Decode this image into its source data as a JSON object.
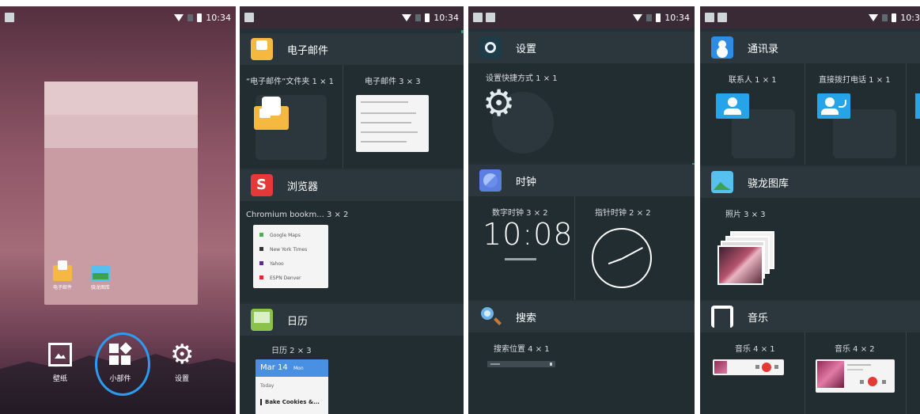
{
  "status": {
    "time": "10:34",
    "time_clipped": "10:3"
  },
  "home": {
    "apps": [
      {
        "label": "电子邮件",
        "icon": "mail-icon"
      },
      {
        "label": "骁龙图库",
        "icon": "gallery-icon"
      }
    ],
    "buttons": [
      {
        "label": "壁纸",
        "icon": "wallpaper-icon"
      },
      {
        "label": "小部件",
        "icon": "widgets-icon",
        "selected": true
      },
      {
        "label": "设置",
        "icon": "gear-icon"
      }
    ]
  },
  "panel2": {
    "sections": [
      {
        "title": "电子邮件",
        "icon": "email-app-icon",
        "widgets": [
          {
            "label": "“电子邮件”文件夹 1 × 1"
          },
          {
            "label": "电子邮件 3 × 3"
          }
        ]
      },
      {
        "title": "浏览器",
        "icon": "browser-icon",
        "widgets": [
          {
            "label": "Chromium bookm... 3 × 2"
          }
        ],
        "bookmarks": [
          "Google Maps",
          "New York Times",
          "Yahoo",
          "ESPN Denver"
        ]
      },
      {
        "title": "日历",
        "icon": "calendar-icon",
        "widgets": [
          {
            "label": "日历 2 × 3"
          }
        ],
        "calendar": {
          "date": "Mar 14",
          "day": "Mon",
          "today": "Today",
          "event": "Bake Cookies &..."
        }
      }
    ]
  },
  "panel3": {
    "sections": [
      {
        "title": "设置",
        "icon": "settings-app-icon",
        "widgets": [
          {
            "label": "设置快捷方式 1 × 1"
          }
        ]
      },
      {
        "title": "时钟",
        "icon": "clock-app-icon",
        "widgets": [
          {
            "label": "数字时钟 3 × 2",
            "time": "10:08"
          },
          {
            "label": "指针时钟 2 × 2"
          }
        ]
      },
      {
        "title": "搜索",
        "icon": "search-app-icon",
        "widgets": [
          {
            "label": "搜索位置 4 × 1"
          }
        ]
      }
    ]
  },
  "panel4": {
    "sections": [
      {
        "title": "通讯录",
        "icon": "contacts-app-icon",
        "widgets": [
          {
            "label": "联系人 1 × 1"
          },
          {
            "label": "直接拨打电话 1 × 1"
          }
        ]
      },
      {
        "title": "骁龙图库",
        "icon": "gallery-app-icon",
        "widgets": [
          {
            "label": "照片 3 × 3"
          }
        ]
      },
      {
        "title": "音乐",
        "icon": "music-app-icon",
        "widgets": [
          {
            "label": "音乐 4 × 1"
          },
          {
            "label": "音乐 4 × 2"
          }
        ]
      }
    ]
  },
  "colors": {
    "accent_ring": "#2d9bf0",
    "panel_bg": "#222d32",
    "header_bg": "#2b373d"
  }
}
